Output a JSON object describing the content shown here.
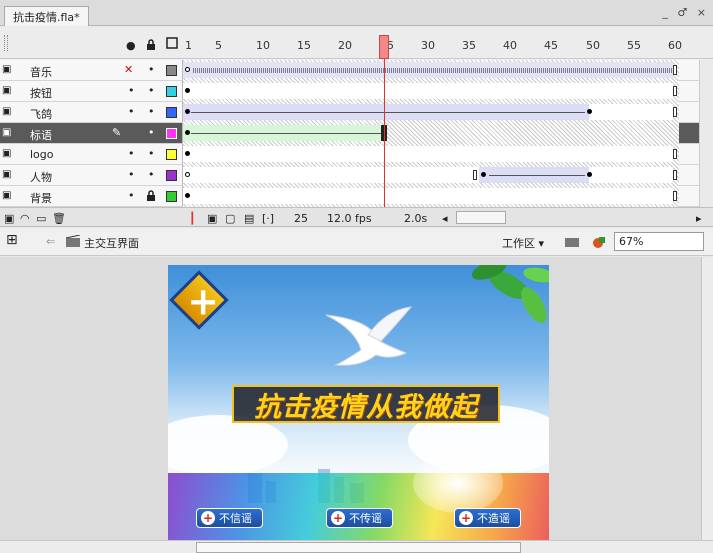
{
  "document": {
    "tab_title": "抗击疫情.fla*",
    "window_controls": "_ ♂ ×"
  },
  "timeline": {
    "header_icons": {
      "eye": "●",
      "lock": "🔒",
      "outline": "□"
    },
    "frame_numbers": [
      "1",
      "5",
      "10",
      "15",
      "20",
      "25",
      "30",
      "35",
      "40",
      "45",
      "50",
      "55",
      "60"
    ],
    "layers": [
      {
        "name": "音乐",
        "visible": "✕",
        "lock": "•",
        "color": "#888888",
        "selected": false
      },
      {
        "name": "按钮",
        "visible": "•",
        "lock": "•",
        "color": "#33d0e0",
        "selected": false
      },
      {
        "name": "飞鸽",
        "visible": "•",
        "lock": "•",
        "color": "#3366ff",
        "selected": false
      },
      {
        "name": "标语",
        "visible": "✎",
        "lock": "•",
        "color": "#ff33ff",
        "selected": true
      },
      {
        "name": "logo",
        "visible": "•",
        "lock": "•",
        "color": "#ffff33",
        "selected": false
      },
      {
        "name": "人物",
        "visible": "•",
        "lock": "•",
        "color": "#9933cc",
        "selected": false
      },
      {
        "name": "背景",
        "visible": "•",
        "lock": "🔒",
        "color": "#33cc33",
        "selected": false
      }
    ],
    "status": {
      "current_frame": "25",
      "fps": "12.0 fps",
      "time": "2.0s"
    }
  },
  "editbar": {
    "scene_label": "主交互界面",
    "workspace_label": "工作区 ▾",
    "zoom": "67%"
  },
  "stage": {
    "headline": "抗击疫情从我做起",
    "buttons": [
      "不信谣",
      "不传谣",
      "不造谣"
    ]
  },
  "colors": {
    "playhead": "#d33333",
    "selected_layer": "#5a5a5a"
  }
}
